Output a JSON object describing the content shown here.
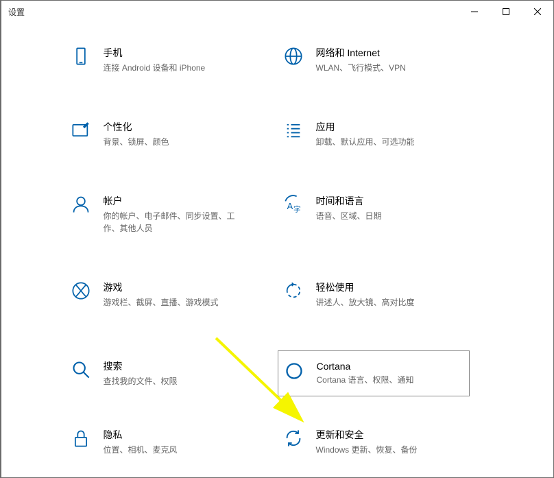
{
  "window": {
    "title": "设置"
  },
  "tiles": {
    "phone": {
      "title": "手机",
      "desc": "连接 Android 设备和 iPhone"
    },
    "network": {
      "title": "网络和 Internet",
      "desc": "WLAN、飞行模式、VPN"
    },
    "personalize": {
      "title": "个性化",
      "desc": "背景、锁屏、颜色"
    },
    "apps": {
      "title": "应用",
      "desc": "卸载、默认应用、可选功能"
    },
    "accounts": {
      "title": "帐户",
      "desc": "你的帐户、电子邮件、同步设置、工作、其他人员"
    },
    "time": {
      "title": "时间和语言",
      "desc": "语音、区域、日期"
    },
    "gaming": {
      "title": "游戏",
      "desc": "游戏栏、截屏、直播、游戏模式"
    },
    "ease": {
      "title": "轻松使用",
      "desc": "讲述人、放大镜、高对比度"
    },
    "search": {
      "title": "搜索",
      "desc": "查找我的文件、权限"
    },
    "cortana": {
      "title": "Cortana",
      "desc": "Cortana 语言、权限、通知"
    },
    "privacy": {
      "title": "隐私",
      "desc": "位置、相机、麦克风"
    },
    "update": {
      "title": "更新和安全",
      "desc": "Windows 更新、恢复、备份"
    }
  }
}
